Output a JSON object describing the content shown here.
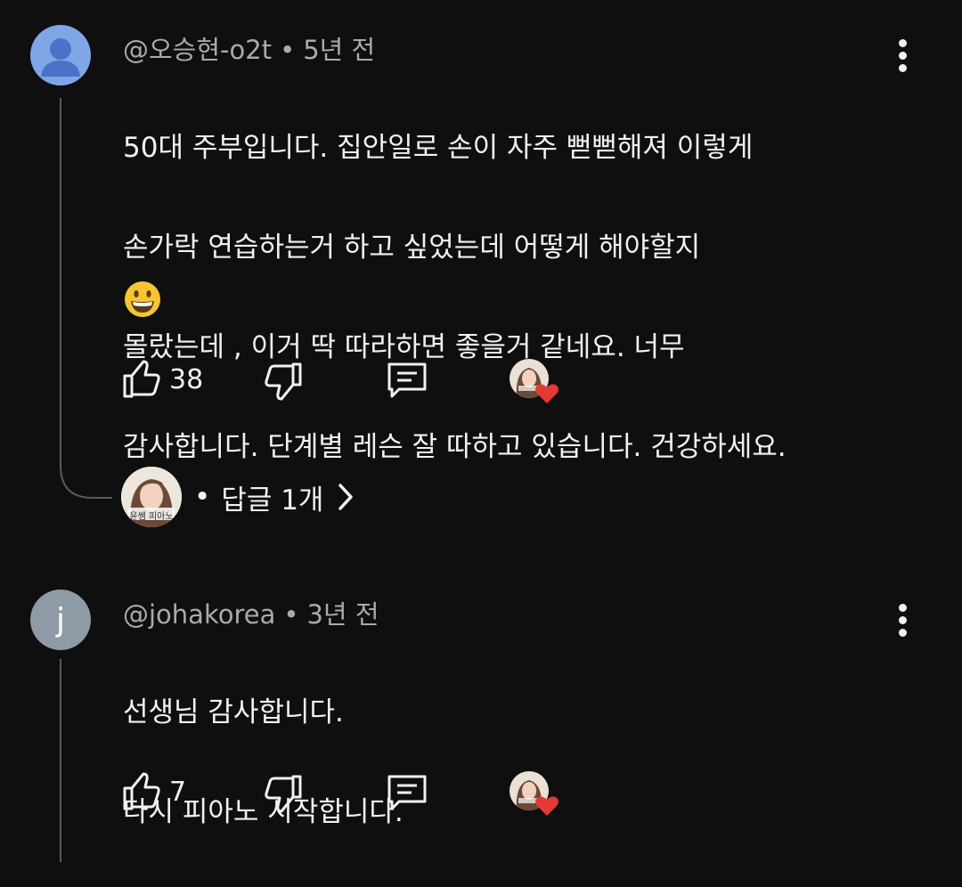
{
  "comments": [
    {
      "author": "@오승현-o2t",
      "time": "5년 전",
      "lines": [
        "50대 주부입니다. 집안일로 손이 자주 뻗뻗해져 이렇게",
        "손가락 연습하는거 하고 싶었는데 어떻게 해야할지",
        "몰랐는데 , 이거 딱 따라하면 좋을거 같네요. 너무",
        "감사합니다. 단계별 레슨 잘 따하고 있습니다. 건강하세요."
      ],
      "emoji": "grinning-face-emoji",
      "likes": "38",
      "replies_label": "답글 1개",
      "creator_avatar_caption": "윤쌤 피아노"
    },
    {
      "author": "@johakorea",
      "avatar_letter": "j",
      "time": "3년 전",
      "lines": [
        "선생님 감사합니다.",
        "다시 피아노 시작합니다."
      ],
      "likes": "7"
    }
  ],
  "separator_dot": "•",
  "colors": {
    "background": "#0f0f0f",
    "text": "#f1f1f1",
    "meta": "#aaaaaa",
    "heart": "#e53935",
    "default_avatar": "#7fa6e6"
  },
  "icons": [
    "like-icon",
    "dislike-icon",
    "reply-icon",
    "creator-heart-icon",
    "more-options-icon",
    "chevron-right-icon"
  ]
}
